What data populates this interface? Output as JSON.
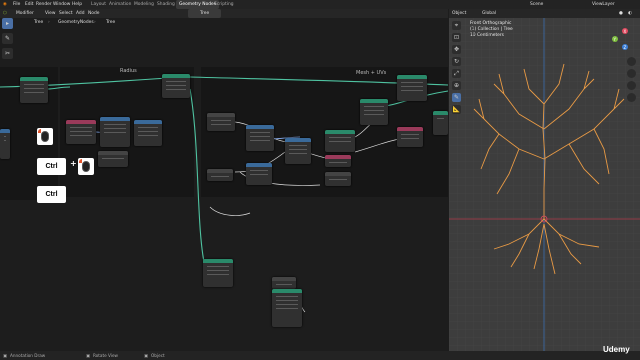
{
  "menu": {
    "items": [
      "File",
      "Edit",
      "Render",
      "Window",
      "Help"
    ],
    "workspaces": [
      "Layout",
      "Animation",
      "Modeling",
      "Shading",
      "Geometry Nodes",
      "Scripting"
    ],
    "active_workspace": "Geometry Nodes",
    "object_name": "Tree",
    "scene": "Scene",
    "view_layer": "ViewLayer"
  },
  "node_header": {
    "editor_type": "Geometry Node Editor",
    "modifier": "Modifier",
    "menus": [
      "View",
      "Select",
      "Add",
      "Node"
    ]
  },
  "breadcrumb": [
    "Tree",
    "GeometryNodes",
    "Tree"
  ],
  "frames": [
    {
      "label": "Radius"
    },
    {
      "label": "Mesh + UVs"
    }
  ],
  "shortcuts": {
    "key1": "Ctrl",
    "plus": "+",
    "key2": "Ctrl"
  },
  "viewport": {
    "mode": "Object",
    "orientation": "Global",
    "view_name": "Front Orthographic",
    "collection_line": "(1) Collection | Tree",
    "units_line": "10 Centimeters",
    "axis_labels": [
      "X",
      "Y",
      "Z"
    ],
    "colors": {
      "x_axis": "#e0495f",
      "y_axis": "#7fbf3f",
      "z_axis": "#3b7fd8",
      "curves": "#e89a45"
    }
  },
  "status": {
    "left": "Annotation Draw",
    "middle": "Rotate View",
    "right": "Object"
  },
  "watermark": "Udemy"
}
